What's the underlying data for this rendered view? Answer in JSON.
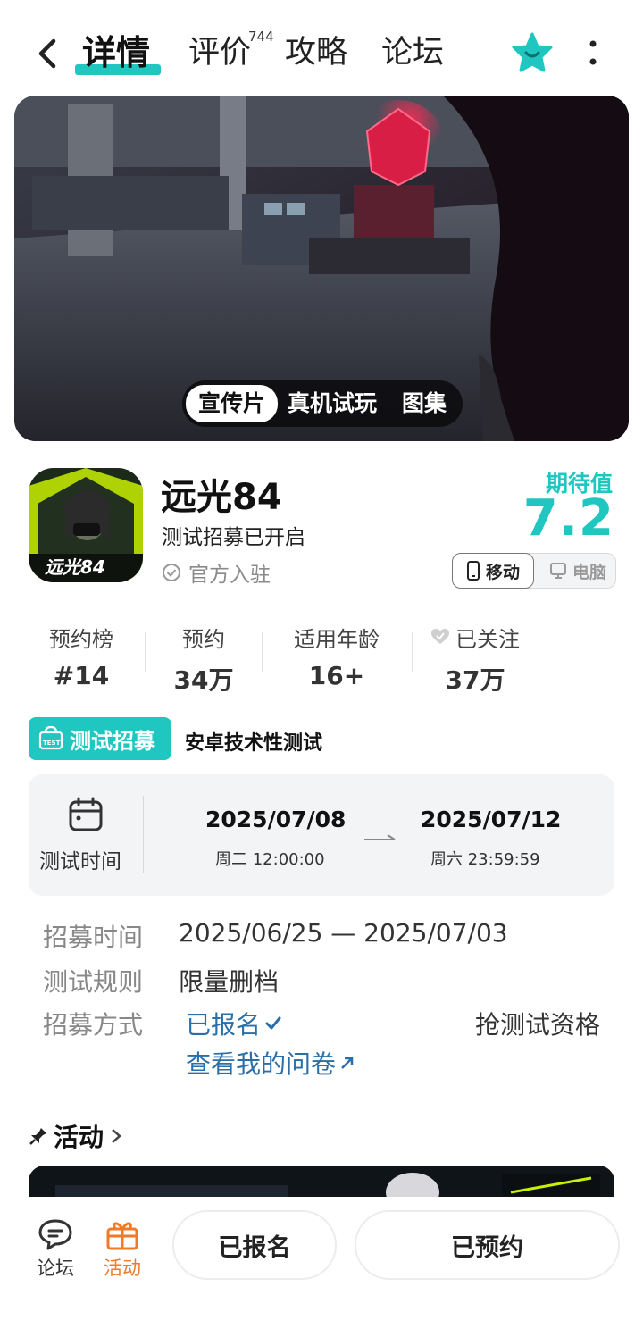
{
  "nav": {
    "tabs": [
      {
        "label": "详情",
        "active": true
      },
      {
        "label": "评价",
        "badge": "744"
      },
      {
        "label": "攻略"
      },
      {
        "label": "论坛"
      }
    ]
  },
  "banner": {
    "media_tabs": [
      "宣传片",
      "真机试玩",
      "图集"
    ],
    "active_media_tab": "宣传片"
  },
  "game": {
    "title": "远光84",
    "subtitle": "测试招募已开启",
    "official": "官方入驻",
    "expect_label": "期待值",
    "expect_score": "7.2",
    "platforms": {
      "mobile": "移动",
      "pc": "电脑"
    }
  },
  "stats": [
    {
      "label": "预约榜",
      "value": "#14"
    },
    {
      "label": "预约",
      "value": "34万"
    },
    {
      "label": "适用年龄",
      "value": "16+"
    },
    {
      "label": "已关注",
      "value": "37万"
    }
  ],
  "recruit": {
    "tag": "测试招募",
    "type": "安卓技术性测试",
    "time_label": "测试时间",
    "start_date": "2025/07/08",
    "start_detail": "周二  12:00:00",
    "end_date": "2025/07/12",
    "end_detail": "周六  23:59:59",
    "details": {
      "recruit_time_label": "招募时间",
      "recruit_time_value": "2025/06/25 — 2025/07/03",
      "rule_label": "测试规则",
      "rule_value": "限量删档",
      "method_label": "招募方式",
      "signed_up": "已报名",
      "questionnaire": "查看我的问卷",
      "grab_slot": "抢测试资格"
    }
  },
  "activity": {
    "title": "活动"
  },
  "bottom": {
    "forum": "论坛",
    "activity": "活动",
    "signed_btn": "已报名",
    "reserved_btn": "已预约"
  },
  "colors": {
    "accent": "#1fc7c0",
    "link": "#2a6fa8",
    "orange": "#f07a28"
  }
}
